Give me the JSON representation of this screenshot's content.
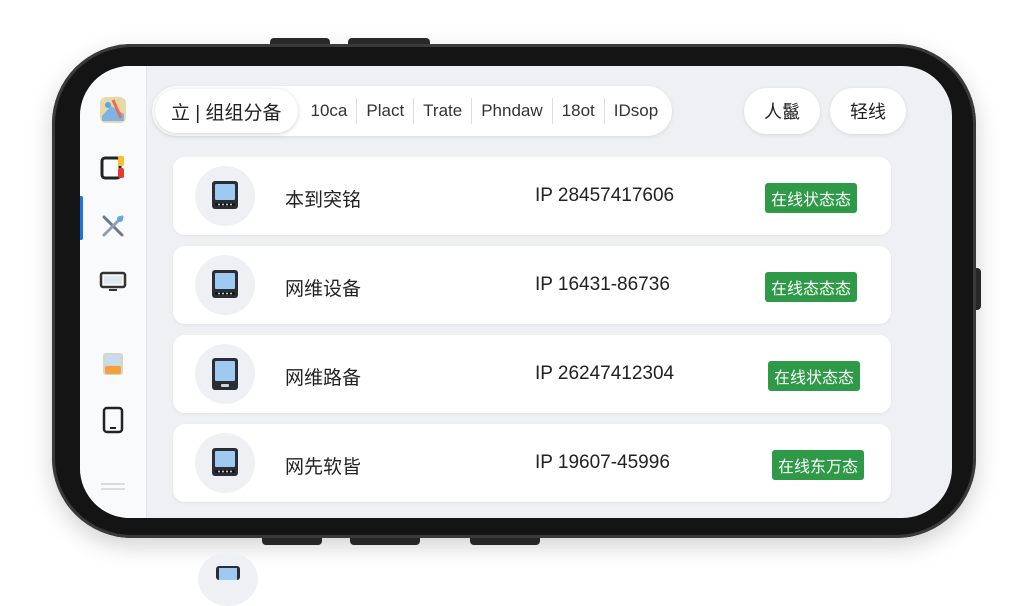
{
  "tabs": {
    "active_label": "立 | 组组分备",
    "items": [
      "10ca",
      "Plact",
      "Trate",
      "Phndaw",
      "18ot",
      "IDsop"
    ]
  },
  "actions": {
    "first_label": "人鬣",
    "second_label": "轻线"
  },
  "sidebar": {
    "icons": [
      "maps-app-icon",
      "apps-grid-icon",
      "crossed-tools-icon",
      "monitor-icon",
      "folder-icon",
      "tablet-icon",
      "handle-icon"
    ]
  },
  "devices": [
    {
      "name": "本到突铭",
      "ip": "IP 28457417606",
      "status": "在线状态态"
    },
    {
      "name": "网维设备",
      "ip": "IP 16431‑86736",
      "status": "在线态态态"
    },
    {
      "name": "网维路备",
      "ip": "IP 26247412304",
      "status": "在线状态态"
    },
    {
      "name": "网先软皆",
      "ip": "IP 19607-45996",
      "status": "在线东万态"
    }
  ],
  "colors": {
    "status_green": "#2e9a47",
    "accent_blue": "#1a73e8",
    "phone_frame": "#141414",
    "screen_bg": "#eef0f4"
  }
}
